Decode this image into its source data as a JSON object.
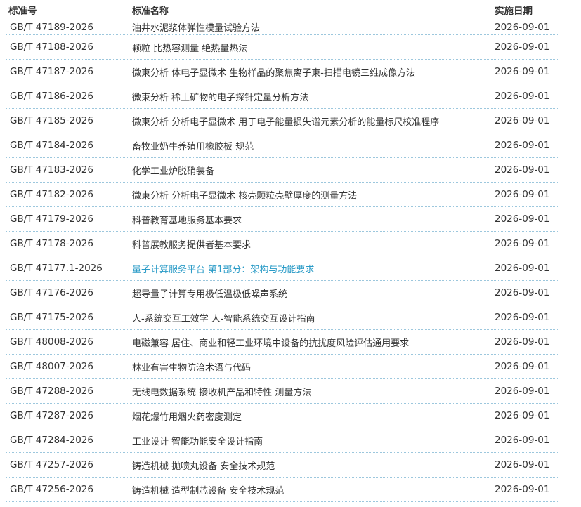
{
  "headers": {
    "code": "标准号",
    "name": "标准名称",
    "date": "实施日期"
  },
  "colors": {
    "link_highlight": "#2a9bc7",
    "row_divider": "#9cc7dd",
    "text": "#333333"
  },
  "rows": [
    {
      "code": "GB/T 47189-2026",
      "name": "油井水泥浆体弹性模量试验方法",
      "date": "2026-09-01"
    },
    {
      "code": "GB/T 47188-2026",
      "name": "颗粒 比热容测量 绝热量热法",
      "date": "2026-09-01"
    },
    {
      "code": "GB/T 47187-2026",
      "name": "微束分析 体电子显微术 生物样品的聚焦离子束-扫描电镜三维成像方法",
      "date": "2026-09-01"
    },
    {
      "code": "GB/T 47186-2026",
      "name": "微束分析 稀土矿物的电子探针定量分析方法",
      "date": "2026-09-01"
    },
    {
      "code": "GB/T 47185-2026",
      "name": "微束分析 分析电子显微术 用于电子能量损失谱元素分析的能量标尺校准程序",
      "date": "2026-09-01"
    },
    {
      "code": "GB/T 47184-2026",
      "name": "畜牧业奶牛养殖用橡胶板 规范",
      "date": "2026-09-01"
    },
    {
      "code": "GB/T 47183-2026",
      "name": "化学工业炉脱硝装备",
      "date": "2026-09-01"
    },
    {
      "code": "GB/T 47182-2026",
      "name": "微束分析 分析电子显微术 核壳颗粒壳壁厚度的测量方法",
      "date": "2026-09-01"
    },
    {
      "code": "GB/T 47179-2026",
      "name": "科普教育基地服务基本要求",
      "date": "2026-09-01"
    },
    {
      "code": "GB/T 47178-2026",
      "name": "科普展教服务提供者基本要求",
      "date": "2026-09-01"
    },
    {
      "code": "GB/T 47177.1-2026",
      "name": "量子计算服务平台 第1部分：架构与功能要求",
      "date": "2026-09-01",
      "highlight": true
    },
    {
      "code": "GB/T 47176-2026",
      "name": "超导量子计算专用极低温极低噪声系统",
      "date": "2026-09-01"
    },
    {
      "code": "GB/T 47175-2026",
      "name": "人-系统交互工效学 人-智能系统交互设计指南",
      "date": "2026-09-01"
    },
    {
      "code": "GB/T 48008-2026",
      "name": "电磁兼容 居住、商业和轻工业环境中设备的抗扰度风险评估通用要求",
      "date": "2026-09-01"
    },
    {
      "code": "GB/T 48007-2026",
      "name": "林业有害生物防治术语与代码",
      "date": "2026-09-01"
    },
    {
      "code": "GB/T 47288-2026",
      "name": "无线电数据系统 接收机产品和特性 测量方法",
      "date": "2026-09-01"
    },
    {
      "code": "GB/T 47287-2026",
      "name": "烟花爆竹用烟火药密度测定",
      "date": "2026-09-01"
    },
    {
      "code": "GB/T 47284-2026",
      "name": "工业设计 智能功能安全设计指南",
      "date": "2026-09-01"
    },
    {
      "code": "GB/T 47257-2026",
      "name": "铸造机械 抛喷丸设备 安全技术规范",
      "date": "2026-09-01"
    },
    {
      "code": "GB/T 47256-2026",
      "name": "铸造机械 造型制芯设备 安全技术规范",
      "date": "2026-09-01"
    }
  ]
}
